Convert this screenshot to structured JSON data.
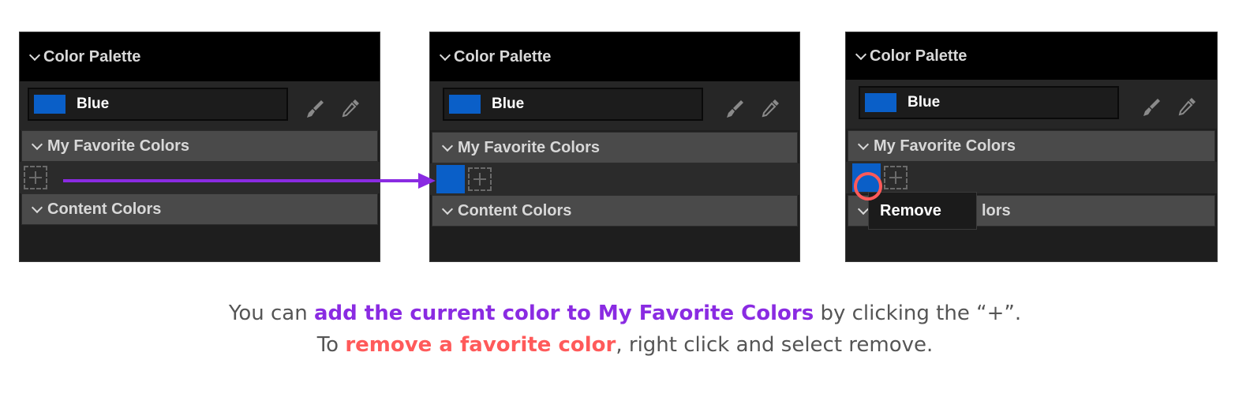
{
  "accent": {
    "blue": "#0a5fc8",
    "purple": "#8a2be2",
    "red": "#ff5a5a"
  },
  "panels": [
    {
      "header": "Color Palette",
      "color_name": "Blue",
      "favorites_section": "My Favorite Colors",
      "content_section": "Content Colors"
    },
    {
      "header": "Color Palette",
      "color_name": "Blue",
      "favorites_section": "My Favorite Colors",
      "content_section": "Content Colors"
    },
    {
      "header": "Color Palette",
      "color_name": "Blue",
      "favorites_section": "My Favorite Colors",
      "content_section_visible": "lors",
      "context_menu": "Remove"
    }
  ],
  "icons": {
    "header_toggle": "chevron-down-icon",
    "brush": "paint-brush-icon",
    "eyedropper": "eyedropper-icon",
    "add": "plus-icon"
  },
  "caption": {
    "line1_prefix": "You can ",
    "line1_highlight": "add the current color to My Favorite Colors",
    "line1_suffix": " by clicking the “+”.",
    "line2_prefix": "To ",
    "line2_highlight": "remove a favorite color",
    "line2_suffix": ", right click and select remove."
  }
}
